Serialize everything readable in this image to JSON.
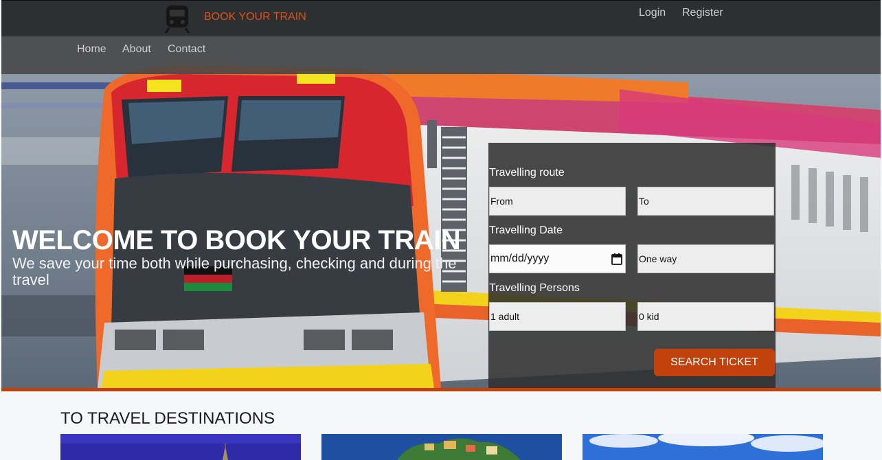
{
  "brand": {
    "name": "BOOK YOUR TRAIN",
    "logo_icon": "train-icon"
  },
  "header": {
    "login_label": "Login",
    "register_label": "Register"
  },
  "nav": {
    "items": [
      "Home",
      "About",
      "Contact"
    ]
  },
  "hero": {
    "title": "WELCOME TO BOOK YOUR TRAIN",
    "tagline": "We save your time both while purchasing, checking and during the travel"
  },
  "booking": {
    "route_label": "Travelling route",
    "from_value": "From",
    "to_value": "To",
    "date_label": "Travelling Date",
    "date_value": "mm/dd/yyyy",
    "trip_type_value": "One way",
    "persons_label": "Travelling Persons",
    "adults_value": "1 adult",
    "kids_value": "0 kid",
    "search_label": "SEARCH TICKET"
  },
  "destinations": {
    "title": "TO TRAVEL DESTINATIONS"
  },
  "colors": {
    "accent": "#c2410c",
    "brand_text": "#d9531e"
  }
}
